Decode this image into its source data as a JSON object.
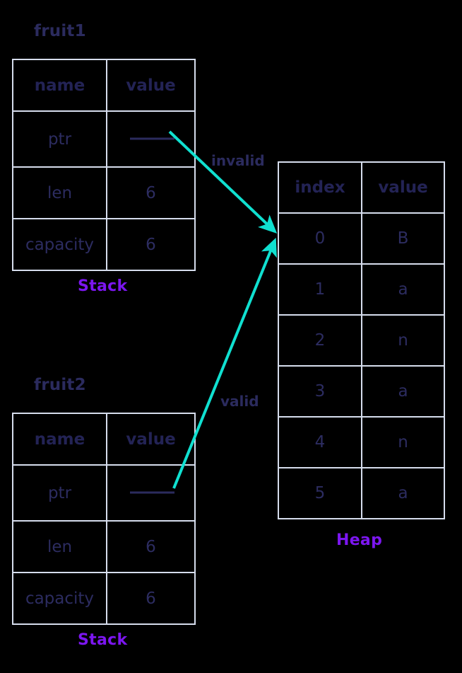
{
  "diagram": {
    "title_hidden": "",
    "colors": {
      "background": "#000000",
      "grid_line": "#d6dded",
      "text_navy": "#2c2c60",
      "accent_purple": "#7c16f0",
      "arrow_cyan": "#10e0d0",
      "pointer_line": "#2b2b5e"
    }
  },
  "stack_blocks": [
    {
      "name": "fruit1",
      "label": "fruit1",
      "region_label": "Stack",
      "columns": [
        "name",
        "value"
      ],
      "rows": [
        {
          "name": "ptr",
          "value": "",
          "is_pointer": true
        },
        {
          "name": "len",
          "value": "6",
          "is_pointer": false
        },
        {
          "name": "capacity",
          "value": "6",
          "is_pointer": false
        }
      ]
    },
    {
      "name": "fruit2",
      "label": "fruit2",
      "region_label": "Stack",
      "columns": [
        "name",
        "value"
      ],
      "rows": [
        {
          "name": "ptr",
          "value": "",
          "is_pointer": true
        },
        {
          "name": "len",
          "value": "6",
          "is_pointer": false
        },
        {
          "name": "capacity",
          "value": "6",
          "is_pointer": false
        }
      ]
    }
  ],
  "heap_block": {
    "region_label": "Heap",
    "columns": [
      "index",
      "value"
    ],
    "rows": [
      {
        "index": "0",
        "value": "B"
      },
      {
        "index": "1",
        "value": "a"
      },
      {
        "index": "2",
        "value": "n"
      },
      {
        "index": "3",
        "value": "a"
      },
      {
        "index": "4",
        "value": "n"
      },
      {
        "index": "5",
        "value": "a"
      }
    ]
  },
  "edges": [
    {
      "id": "invalid",
      "label": "invalid",
      "from": "fruit1.ptr",
      "to": "heap.index0"
    },
    {
      "id": "valid",
      "label": "valid",
      "from": "fruit2.ptr",
      "to": "heap.index0"
    }
  ]
}
